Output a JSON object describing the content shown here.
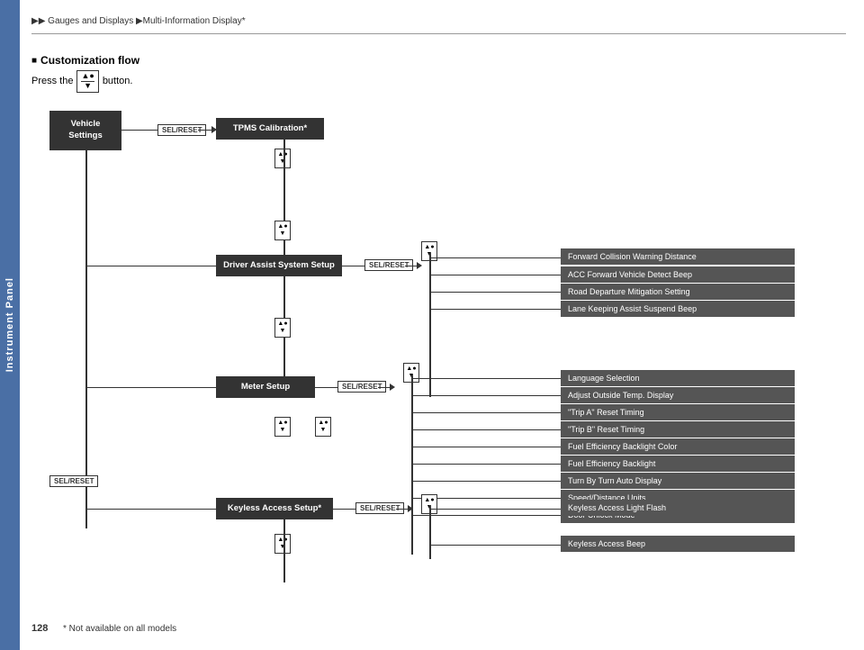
{
  "breadcrumb": {
    "parts": [
      "▶▶",
      "Gauges and Displays",
      "▶",
      "Multi-Information Display*"
    ]
  },
  "sidebar": {
    "label": "Instrument Panel"
  },
  "section": {
    "title": "Customization flow",
    "subtitle_prefix": "Press the",
    "subtitle_suffix": "button.",
    "button_label": "▲●/▼"
  },
  "page": {
    "number": "128",
    "footnote": "* Not available on all models"
  },
  "boxes": {
    "vehicle_settings": "Vehicle\nSettings",
    "tpms": "TPMS Calibration*",
    "driver_assist": "Driver Assist System Setup",
    "meter_setup": "Meter Setup",
    "keyless_access": "Keyless Access Setup*"
  },
  "sel_reset": "SEL/RESET",
  "menu_items": [
    "Forward Collision Warning Distance",
    "ACC Forward Vehicle Detect Beep",
    "Road Departure Mitigation Setting",
    "Lane Keeping Assist Suspend Beep",
    "Language Selection",
    "Adjust Outside Temp. Display",
    "\"Trip A\" Reset Timing",
    "\"Trip B\" Reset Timing",
    "Fuel Efficiency Backlight Color",
    "Fuel Efficiency Backlight",
    "Turn By Turn Auto Display",
    "Speed/Distance Units",
    "Door Unlock Mode",
    "Keyless Access Light Flash",
    "Keyless Access Beep"
  ]
}
